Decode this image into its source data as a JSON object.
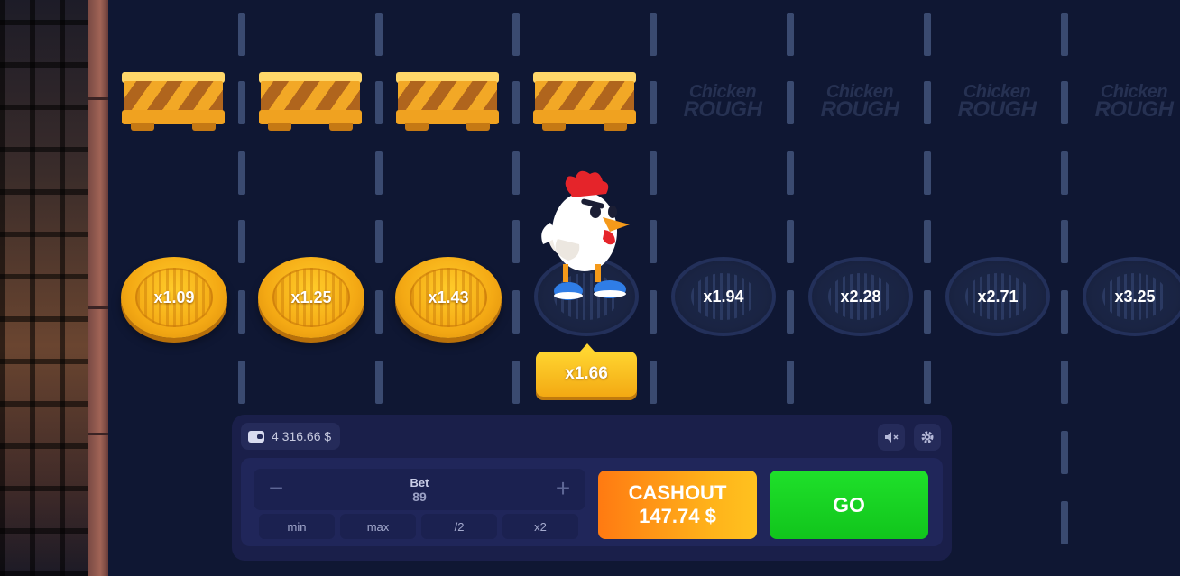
{
  "game": {
    "logo_line1": "Chicken",
    "logo_line2": "ROUGH"
  },
  "lanes": [
    {
      "multiplier": "x1.09",
      "state": "passed"
    },
    {
      "multiplier": "x1.25",
      "state": "passed"
    },
    {
      "multiplier": "x1.43",
      "state": "passed"
    },
    {
      "multiplier": "x1.66",
      "state": "current"
    },
    {
      "multiplier": "x1.94",
      "state": "upcoming"
    },
    {
      "multiplier": "x2.28",
      "state": "upcoming"
    },
    {
      "multiplier": "x2.71",
      "state": "upcoming"
    },
    {
      "multiplier": "x3.25",
      "state": "upcoming"
    }
  ],
  "current_multiplier": "x1.66",
  "balance": {
    "amount": "4 316.66 $",
    "icon": "wallet-icon"
  },
  "panel_icons": {
    "sound": "speaker-muted-icon",
    "settings": "gear-icon"
  },
  "bet": {
    "label": "Bet",
    "value": "89",
    "minus": "−",
    "plus": "+",
    "quick": [
      "min",
      "max",
      "/2",
      "x2"
    ]
  },
  "cashout": {
    "label": "CASHOUT",
    "amount": "147.74 $"
  },
  "go": {
    "label": "GO"
  },
  "colors": {
    "coin": "#f4a914",
    "go": "#11c51c",
    "cashout": "#ff8a14",
    "background": "#0f1733"
  }
}
